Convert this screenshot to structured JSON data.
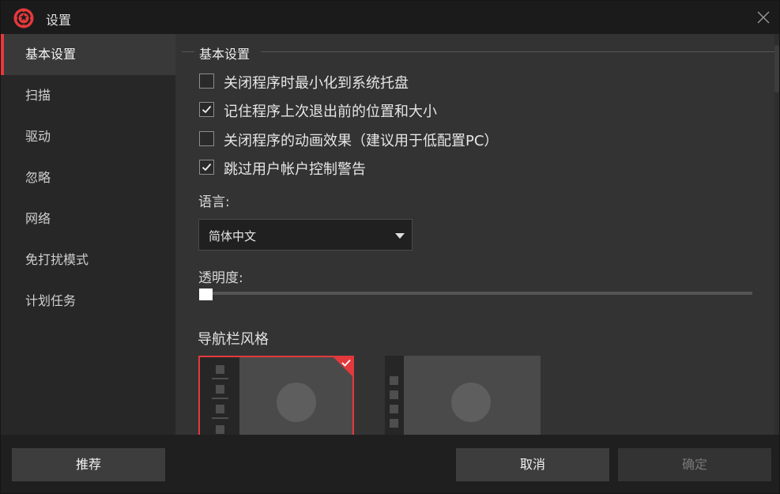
{
  "window": {
    "title": "设置",
    "colors": {
      "accent": "#e4393c",
      "background": "#333333",
      "sidebar": "#272727",
      "titlebar": "#1b1b1b"
    }
  },
  "sidebar": {
    "items": [
      {
        "label": "基本设置",
        "active": true
      },
      {
        "label": "扫描",
        "active": false
      },
      {
        "label": "驱动",
        "active": false
      },
      {
        "label": "忽略",
        "active": false
      },
      {
        "label": "网络",
        "active": false
      },
      {
        "label": "免打扰模式",
        "active": false
      },
      {
        "label": "计划任务",
        "active": false
      }
    ]
  },
  "content": {
    "section_title": "基本设置",
    "options": [
      {
        "label": "关闭程序时最小化到系统托盘",
        "checked": false
      },
      {
        "label": "记住程序上次退出前的位置和大小",
        "checked": true
      },
      {
        "label": "关闭程序的动画效果（建议用于低配置PC）",
        "checked": false
      },
      {
        "label": "跳过用户帐户控制警告",
        "checked": true
      }
    ],
    "language_label": "语言:",
    "language_value": "简体中文",
    "transparency_label": "透明度:",
    "transparency_value": 0,
    "nav_style_label": "导航栏风格",
    "nav_styles": [
      {
        "name": "style-with-dividers",
        "selected": true
      },
      {
        "name": "style-compact",
        "selected": false
      }
    ]
  },
  "buttons": {
    "recommend": "推荐",
    "cancel": "取消",
    "confirm": "确定",
    "confirm_disabled": true
  }
}
